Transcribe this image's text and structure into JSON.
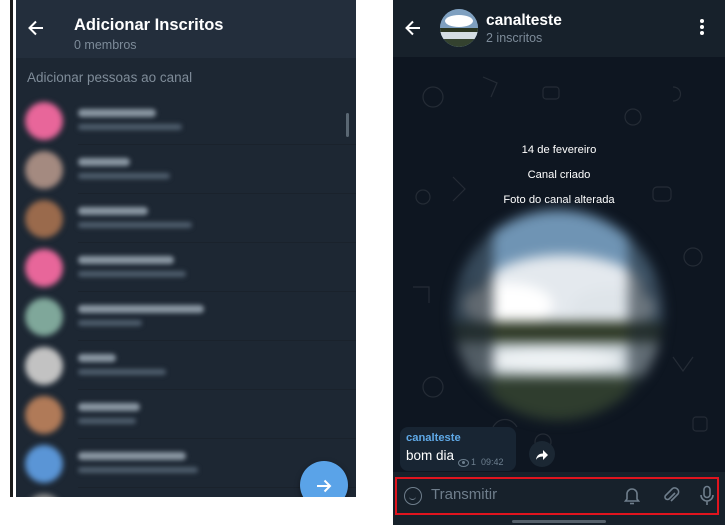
{
  "add_members_screen": {
    "title": "Adicionar Inscritos",
    "subtitle": "0 membros",
    "section_label": "Adicionar pessoas ao canal",
    "contacts": [
      {
        "avatar_color": "#e8669a"
      },
      {
        "avatar_color": "#a48a80"
      },
      {
        "avatar_color": "#9a6a4c"
      },
      {
        "avatar_color": "#e8669a"
      },
      {
        "avatar_color": "#7fa79a"
      },
      {
        "avatar_color": "#c2c2c2"
      },
      {
        "avatar_color": "#b07a58"
      },
      {
        "avatar_color": "#5a95d6"
      },
      {
        "avatar_color": "#8c8c8c"
      }
    ],
    "fab_icon": "arrow-right-icon"
  },
  "channel_screen": {
    "title": "canalteste",
    "subtitle": "2 inscritos",
    "service_messages": {
      "date": "14 de fevereiro",
      "created": "Canal criado",
      "photo_changed": "Foto do canal alterada"
    },
    "message": {
      "author": "canalteste",
      "text": "bom dia",
      "views": "1",
      "time": "09:42"
    },
    "input": {
      "placeholder": "Transmitir",
      "icons": [
        "smile-icon",
        "bell-icon",
        "paperclip-icon",
        "microphone-icon"
      ]
    }
  },
  "colors": {
    "header": "#232e3c",
    "chat_background": "#0e1621",
    "accent": "#5aa3e8",
    "highlight_border": "#e0141e"
  }
}
